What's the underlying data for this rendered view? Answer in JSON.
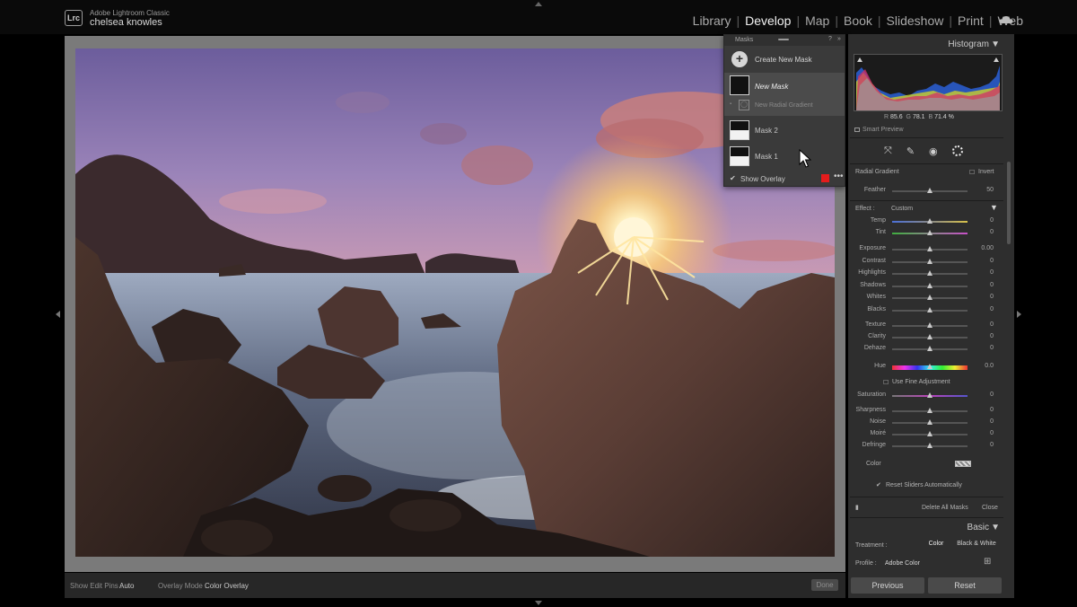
{
  "identity": {
    "app": "Adobe Lightroom Classic",
    "user": "chelsea knowles",
    "badge": "Lrc"
  },
  "modules": [
    "Library",
    "Develop",
    "Map",
    "Book",
    "Slideshow",
    "Print",
    "Web"
  ],
  "active_module": "Develop",
  "toolbar": {
    "show_edit_pins_label": "Show Edit Pins :",
    "show_edit_pins_value": "Auto",
    "overlay_mode_label": "Overlay Mode :",
    "overlay_mode_value": "Color Overlay",
    "done_label": "Done"
  },
  "masks": {
    "title": "Masks",
    "create_label": "Create New Mask",
    "new_mask": {
      "label": "New Mask",
      "component": "New Radial Gradient"
    },
    "items": [
      {
        "label": "Mask 2"
      },
      {
        "label": "Mask 1"
      }
    ],
    "show_overlay_label": "Show Overlay",
    "overlay_color": "#e41c1c"
  },
  "histogram": {
    "title": "Histogram",
    "r_label": "R",
    "r_value": "85.6",
    "g_label": "G",
    "g_value": "78.1",
    "b_label": "B",
    "b_value": "71.4",
    "unit": "%",
    "smart_preview_label": "Smart Preview"
  },
  "mask_settings": {
    "tool_title": "Radial Gradient",
    "invert_label": "Invert",
    "feather_label": "Feather",
    "feather_value": "50",
    "effect_label": "Effect :",
    "effect_value": "Custom",
    "sliders_a": [
      {
        "name": "Temp",
        "value": "0"
      },
      {
        "name": "Tint",
        "value": "0"
      }
    ],
    "sliders_b": [
      {
        "name": "Exposure",
        "value": "0.00"
      },
      {
        "name": "Contrast",
        "value": "0"
      },
      {
        "name": "Highlights",
        "value": "0"
      },
      {
        "name": "Shadows",
        "value": "0"
      },
      {
        "name": "Whites",
        "value": "0"
      },
      {
        "name": "Blacks",
        "value": "0"
      }
    ],
    "sliders_c": [
      {
        "name": "Texture",
        "value": "0"
      },
      {
        "name": "Clarity",
        "value": "0"
      },
      {
        "name": "Dehaze",
        "value": "0"
      }
    ],
    "hue_label": "Hue",
    "hue_value": "0.0",
    "fine_adjust_label": "Use Fine Adjustment",
    "saturation_label": "Saturation",
    "saturation_value": "0",
    "sliders_d": [
      {
        "name": "Sharpness",
        "value": "0"
      },
      {
        "name": "Noise",
        "value": "0"
      },
      {
        "name": "Moiré",
        "value": "0"
      },
      {
        "name": "Defringe",
        "value": "0"
      }
    ],
    "color_label": "Color",
    "reset_sliders_label": "Reset Sliders Automatically",
    "delete_all_label": "Delete All Masks",
    "close_label": "Close"
  },
  "basic": {
    "title": "Basic",
    "treatment_label": "Treatment :",
    "color_option": "Color",
    "bw_option": "Black & White",
    "profile_label": "Profile :",
    "profile_value": "Adobe Color"
  },
  "footer": {
    "previous_label": "Previous",
    "reset_label": "Reset"
  }
}
